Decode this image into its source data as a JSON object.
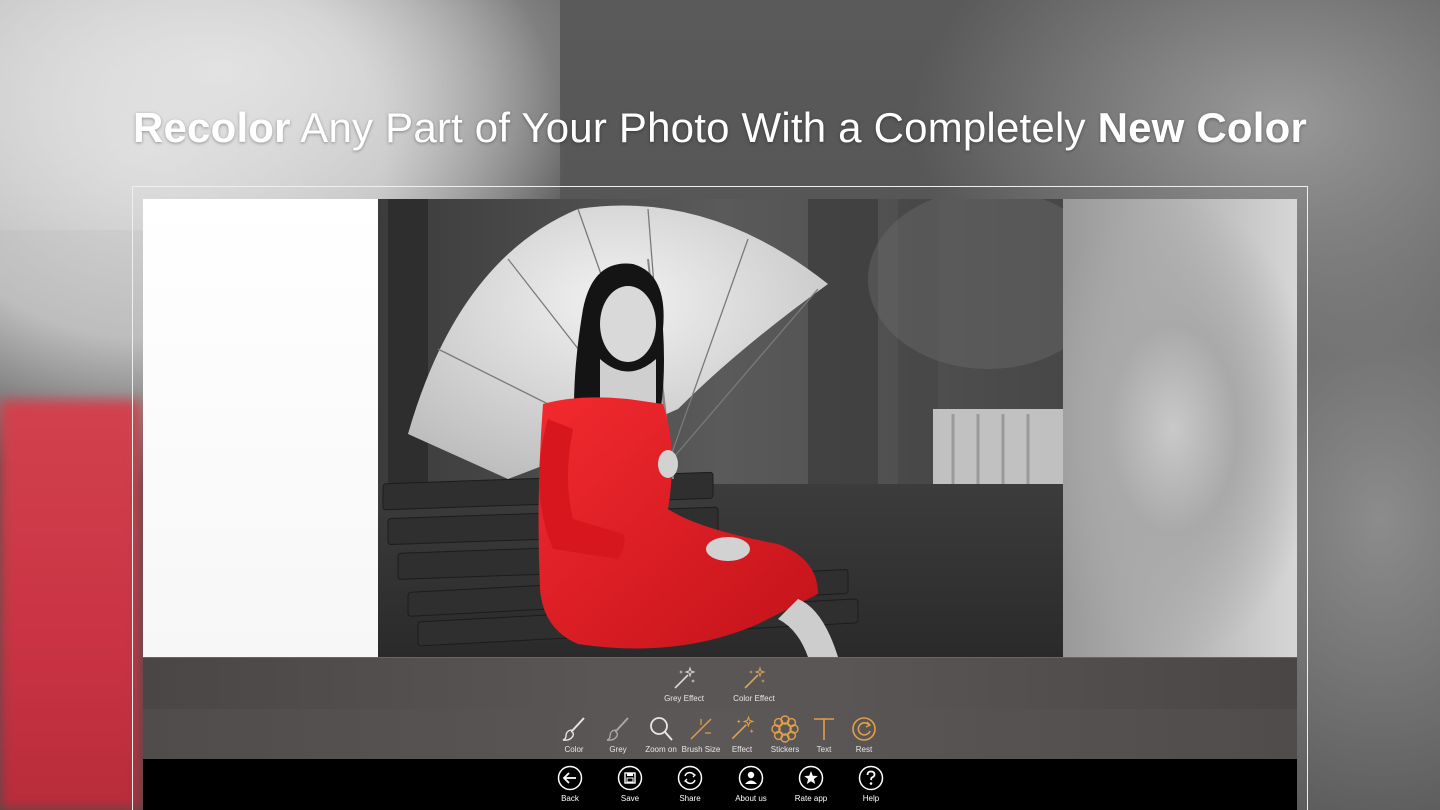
{
  "headline": {
    "bold1": "Recolor",
    "middle": " Any Part of Your Photo With a Completely ",
    "bold2": "New Color"
  },
  "effects_bar": {
    "items": [
      {
        "label": "Grey Effect",
        "icon": "sparkle-wand-icon",
        "color": "#d8d8d8"
      },
      {
        "label": "Color Effect",
        "icon": "sparkle-wand-icon",
        "color": "#d4a55a"
      }
    ]
  },
  "tools_bar": {
    "items": [
      {
        "label": "Color",
        "icon": "brush-icon"
      },
      {
        "label": "Grey",
        "icon": "brush-icon"
      },
      {
        "label": "Zoom on",
        "icon": "magnifier-icon"
      },
      {
        "label": "Brush Size",
        "icon": "brush-size-icon"
      },
      {
        "label": "Effect",
        "icon": "sparkle-wand-icon"
      },
      {
        "label": "Stickers",
        "icon": "sticker-flower-icon"
      },
      {
        "label": "Text",
        "icon": "text-t-icon"
      },
      {
        "label": "Rest",
        "icon": "reset-icon"
      }
    ],
    "accent": "#e0a047"
  },
  "bottom_bar": {
    "items": [
      {
        "label": "Back",
        "icon": "back-arrow-icon"
      },
      {
        "label": "Save",
        "icon": "save-disk-icon"
      },
      {
        "label": "Share",
        "icon": "share-refresh-icon"
      },
      {
        "label": "About us",
        "icon": "person-icon"
      },
      {
        "label": "Rate app",
        "icon": "star-icon"
      },
      {
        "label": "Help",
        "icon": "question-icon"
      }
    ]
  },
  "colors": {
    "dress_red": "#e31b23",
    "toolbar_grey": "#575353",
    "bottom_black": "#000000"
  }
}
